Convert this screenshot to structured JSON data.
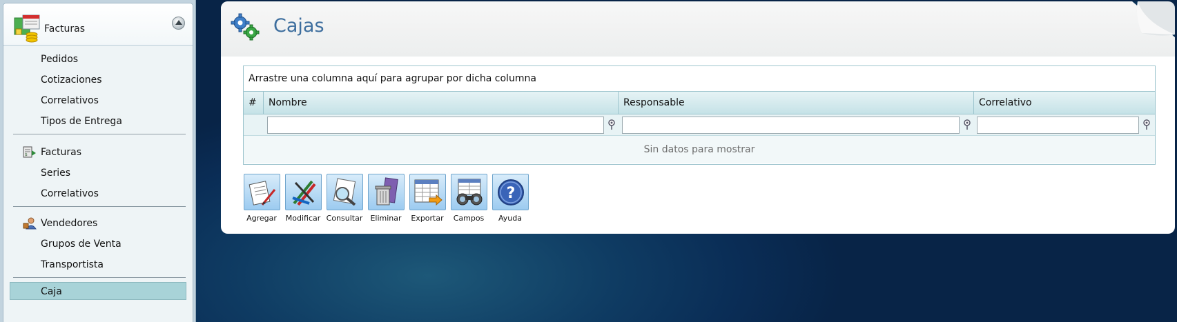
{
  "sidebar": {
    "header_title": "Facturas",
    "items": [
      {
        "label": "Pedidos"
      },
      {
        "label": "Cotizaciones"
      },
      {
        "label": "Correlativos"
      },
      {
        "label": "Tipos de Entrega"
      },
      {
        "label": "Facturas",
        "icon": "invoice-icon"
      },
      {
        "label": "Series"
      },
      {
        "label": "Correlativos"
      },
      {
        "label": "Vendedores",
        "icon": "sellers-icon"
      },
      {
        "label": "Grupos de Venta"
      },
      {
        "label": "Transportista"
      },
      {
        "label": "Caja",
        "active": true
      }
    ]
  },
  "page": {
    "title": "Cajas",
    "title_icon": "gears-icon"
  },
  "grid": {
    "group_panel_text": "Arrastre una columna aquí para agrupar por dicha columna",
    "columns": [
      "#",
      "Nombre",
      "Responsable",
      "Correlativo"
    ],
    "filters": {
      "nombre": "",
      "responsable": "",
      "correlativo": ""
    },
    "empty_text": "Sin datos para mostrar"
  },
  "toolbar": {
    "buttons": [
      {
        "label": "Agregar",
        "icon": "add-document-icon"
      },
      {
        "label": "Modificar",
        "icon": "edit-pencils-icon"
      },
      {
        "label": "Consultar",
        "icon": "magnifier-icon"
      },
      {
        "label": "Eliminar",
        "icon": "trash-icon"
      },
      {
        "label": "Exportar",
        "icon": "spreadsheet-export-icon"
      },
      {
        "label": "Campos",
        "icon": "binoculars-icon"
      },
      {
        "label": "Ayuda",
        "icon": "help-icon"
      }
    ]
  },
  "colors": {
    "title": "#3d6e9e",
    "active_item": "#a8d3d8",
    "grid_header": "#c5e2e7",
    "background": "#0a2d56"
  }
}
